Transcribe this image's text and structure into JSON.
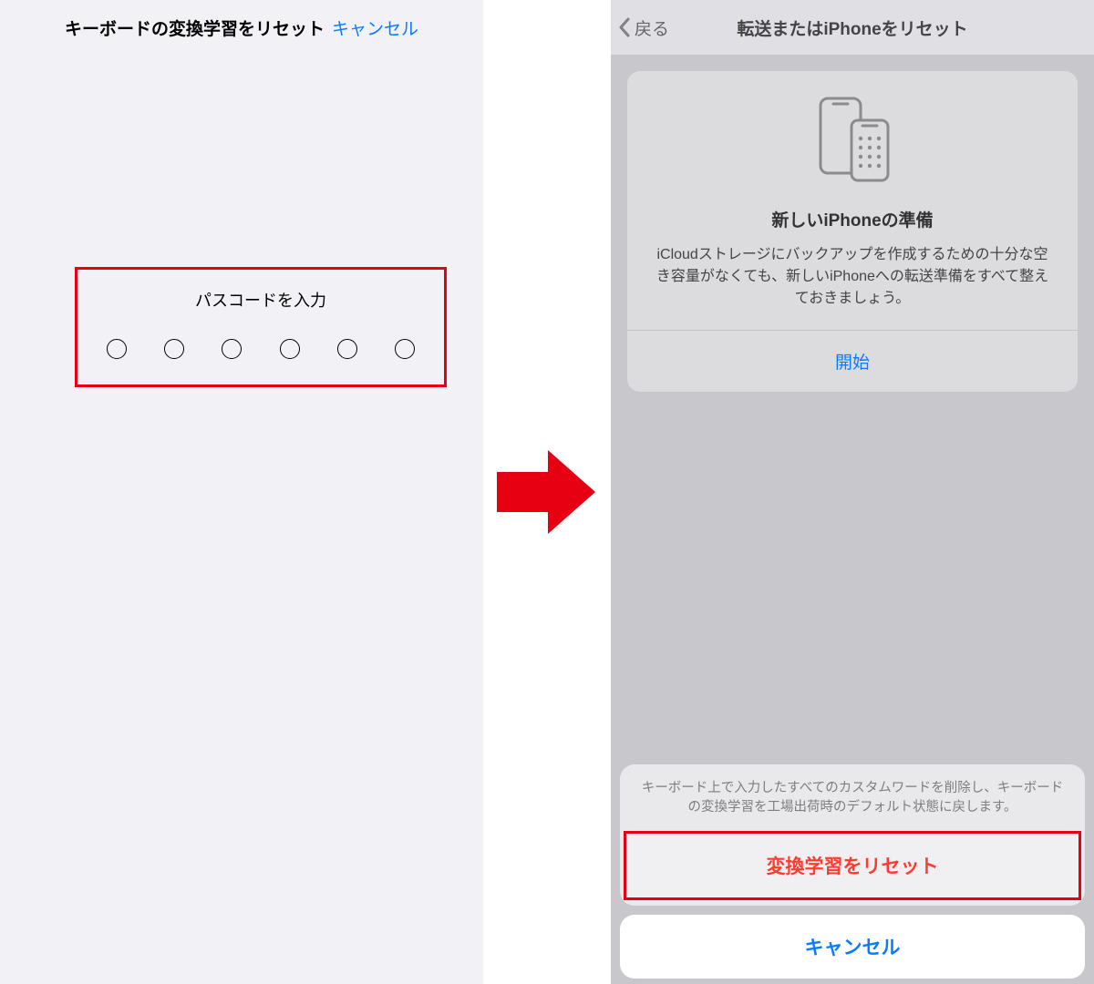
{
  "left": {
    "title": "キーボードの変換学習をリセット",
    "cancel": "キャンセル",
    "passcode_label": "パスコードを入力"
  },
  "right": {
    "back": "戻る",
    "title": "転送またはiPhoneをリセット",
    "card": {
      "title": "新しいiPhoneの準備",
      "desc": "iCloudストレージにバックアップを作成するための十分な空き容量がなくても、新しいiPhoneへの転送準備をすべて整えておきましょう。",
      "action": "開始"
    },
    "sheet": {
      "message": "キーボード上で入力したすべてのカスタムワードを削除し、キーボードの変換学習を工場出荷時のデフォルト状態に戻します。",
      "reset": "変換学習をリセット",
      "cancel": "キャンセル"
    }
  }
}
